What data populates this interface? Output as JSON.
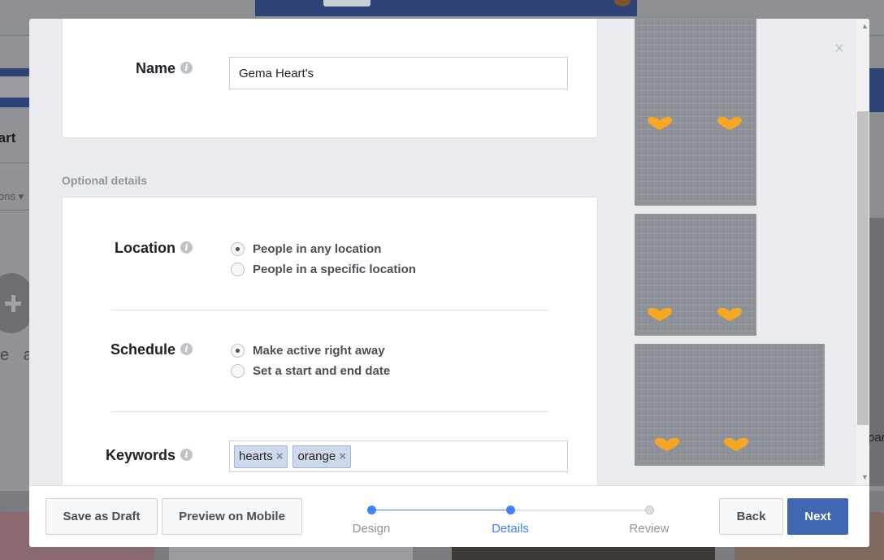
{
  "modal": {
    "name_field": {
      "label": "Name",
      "value": "Gema Heart's"
    },
    "optional_section_caption": "Optional details",
    "location": {
      "label": "Location",
      "options": [
        {
          "label": "People in any location",
          "checked": true
        },
        {
          "label": "People in a specific location",
          "checked": false
        }
      ]
    },
    "schedule": {
      "label": "Schedule",
      "options": [
        {
          "label": "Make active right away",
          "checked": true
        },
        {
          "label": "Set a start and end date",
          "checked": false
        }
      ]
    },
    "keywords": {
      "label": "Keywords",
      "tags": [
        "hearts",
        "orange"
      ]
    },
    "info_icon_glyph": "i",
    "close_glyph": "×",
    "tag_remove_glyph": "×"
  },
  "footer": {
    "save_draft_label": "Save as Draft",
    "preview_mobile_label": "Preview on Mobile",
    "back_label": "Back",
    "next_label": "Next",
    "steps": [
      {
        "label": "Design",
        "state": "done"
      },
      {
        "label": "Details",
        "state": "current"
      },
      {
        "label": "Review",
        "state": "upcoming"
      }
    ]
  },
  "background": {
    "left_heading_fragment": "tart",
    "left_sub_fragment": "ons ▾",
    "left_tail_fragment": "e a",
    "right_fragment": "par"
  },
  "colors": {
    "accent": "#4267b2",
    "step_active": "#4080ff",
    "heart": "#f5a623",
    "preview_bg": "#8d9096"
  }
}
